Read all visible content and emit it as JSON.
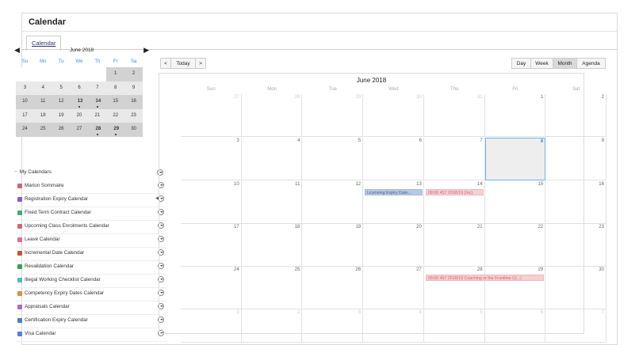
{
  "page": {
    "title": "Calendar",
    "tab_label": "Calendar"
  },
  "mini": {
    "month_label": "June 2018",
    "prev_icon": "▶",
    "next_icon": "▶",
    "weekdays": [
      "Su",
      "Mo",
      "Tu",
      "We",
      "Th",
      "Fr",
      "Sa"
    ],
    "rows": [
      [
        "",
        "",
        "",
        "",
        "",
        "1",
        "2"
      ],
      [
        "3",
        "4",
        "5",
        "6",
        "7",
        "8",
        "9"
      ],
      [
        "10",
        "11",
        "12",
        "13",
        "14",
        "15",
        "16"
      ],
      [
        "17",
        "18",
        "19",
        "20",
        "21",
        "22",
        "23"
      ],
      [
        "24",
        "25",
        "26",
        "27",
        "28",
        "29",
        "30"
      ]
    ],
    "event_days": [
      "13",
      "14",
      "28",
      "29"
    ]
  },
  "my_calendars": {
    "header": "My Calendars",
    "toggle": "−",
    "items": [
      {
        "label": "Marion Sommaire",
        "color": "#d9646b"
      },
      {
        "label": "Registration Expiry Calendar",
        "color": "#8a5cc9"
      },
      {
        "label": "Fixed Term Contract Calendar",
        "color": "#3fae78"
      },
      {
        "label": "Upcoming Class Enrolments Calendar",
        "color": "#d9646b"
      },
      {
        "label": "Leave Calendar",
        "color": "#e36b88"
      },
      {
        "label": "Incremental Date Calendar",
        "color": "#c2553a"
      },
      {
        "label": "Revalidation Calendar",
        "color": "#3a9f4d"
      },
      {
        "label": "Illegal Working Checklist Calendar",
        "color": "#4bbfb5"
      },
      {
        "label": "Competency Expiry Dates Calendar",
        "color": "#e78a3e"
      },
      {
        "label": "Appraisals Calendar",
        "color": "#b367c2"
      },
      {
        "label": "Certification Expiry Calendar",
        "color": "#4f7fb0"
      },
      {
        "label": "Visa Calendar",
        "color": "#4f7fe0"
      }
    ]
  },
  "toolbar": {
    "prev": "<",
    "today": "Today",
    "next": ">"
  },
  "views": [
    "Day",
    "Week",
    "Month",
    "Agenda"
  ],
  "active_view": "Month",
  "month": {
    "title": "June 2018",
    "days_of_week": [
      "Sun",
      "Mon",
      "Tue",
      "Wed",
      "Thu",
      "Fri",
      "Sat"
    ],
    "weeks": [
      [
        {
          "n": "27",
          "o": true
        },
        {
          "n": "28",
          "o": true
        },
        {
          "n": "29",
          "o": true
        },
        {
          "n": "30",
          "o": true
        },
        {
          "n": "31",
          "o": true
        },
        {
          "n": "1"
        },
        {
          "n": "2"
        }
      ],
      [
        {
          "n": "3"
        },
        {
          "n": "4"
        },
        {
          "n": "5"
        },
        {
          "n": "6"
        },
        {
          "n": "7"
        },
        {
          "n": "8",
          "today": true
        },
        {
          "n": "9"
        }
      ],
      [
        {
          "n": "10"
        },
        {
          "n": "11"
        },
        {
          "n": "12"
        },
        {
          "n": "13"
        },
        {
          "n": "14"
        },
        {
          "n": "15"
        },
        {
          "n": "16"
        }
      ],
      [
        {
          "n": "17"
        },
        {
          "n": "18"
        },
        {
          "n": "19"
        },
        {
          "n": "20"
        },
        {
          "n": "21"
        },
        {
          "n": "22"
        },
        {
          "n": "23"
        }
      ],
      [
        {
          "n": "24"
        },
        {
          "n": "25"
        },
        {
          "n": "26"
        },
        {
          "n": "27"
        },
        {
          "n": "28"
        },
        {
          "n": "29"
        },
        {
          "n": "30"
        }
      ],
      [
        {
          "n": "1",
          "o": true
        },
        {
          "n": "2",
          "o": true
        },
        {
          "n": "3",
          "o": true
        },
        {
          "n": "4",
          "o": true
        },
        {
          "n": "5",
          "o": true
        },
        {
          "n": "6",
          "o": true
        },
        {
          "n": "7",
          "o": true
        }
      ]
    ],
    "events": [
      {
        "week": 2,
        "col": 3,
        "span": 1,
        "text": "Licensing Expiry Date...",
        "style": "blue"
      },
      {
        "week": 2,
        "col": 4,
        "span": 1,
        "text": "09:00 457 2018/19 (Inc)",
        "style": "red"
      },
      {
        "week": 4,
        "col": 4,
        "span": 2,
        "text": "09:00 457 2018/19 Coaching at the Frontline C(...)",
        "style": "red"
      }
    ]
  }
}
